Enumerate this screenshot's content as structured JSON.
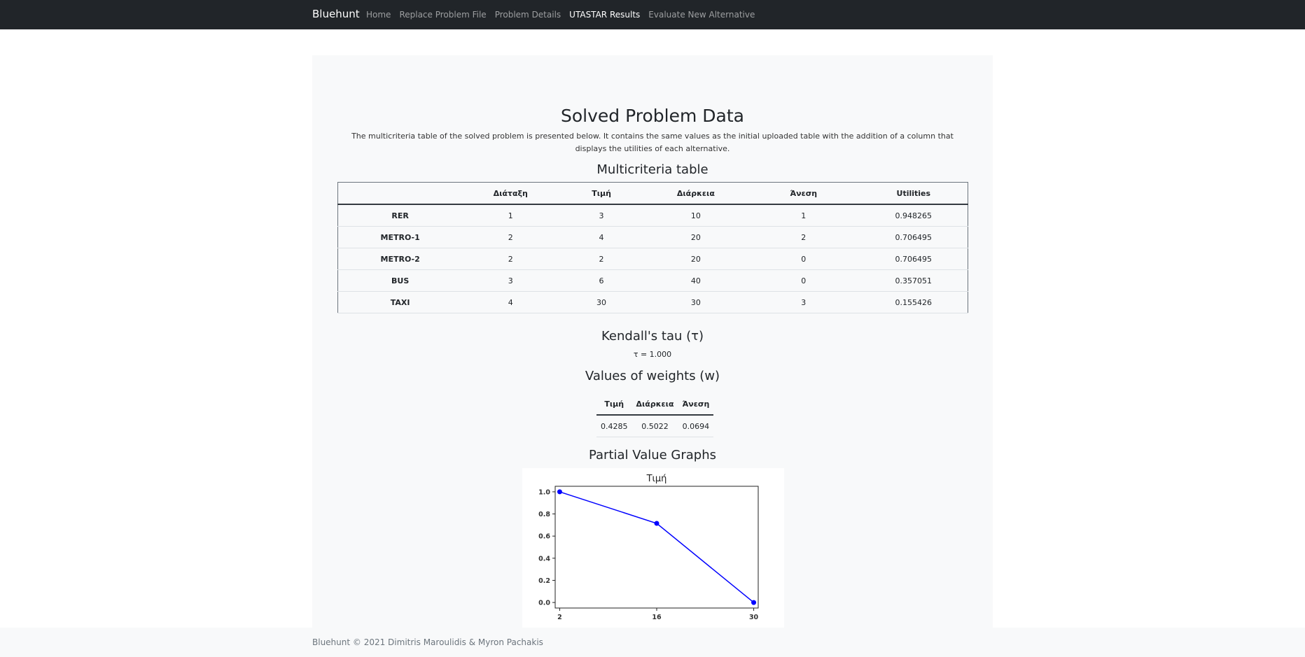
{
  "navbar": {
    "brand": "Bluehunt",
    "items": [
      {
        "label": "Home",
        "active": false
      },
      {
        "label": "Replace Problem File",
        "active": false
      },
      {
        "label": "Problem Details",
        "active": false
      },
      {
        "label": "UTASTAR Results",
        "active": true
      },
      {
        "label": "Evaluate New Alternative",
        "active": false
      }
    ]
  },
  "main": {
    "title": "Solved Problem Data",
    "intro": "The multicriteria table of the solved problem is presented below. It contains the same values as the initial uploaded table with the addition of a column that displays the utilities of each alternative.",
    "multicriteria": {
      "heading": "Multicriteria table",
      "columns": [
        "",
        "Διάταξη",
        "Τιμή",
        "Διάρκεια",
        "Άνεση",
        "Utilities"
      ],
      "rows": [
        {
          "name": "RER",
          "values": [
            "1",
            "3",
            "10",
            "1",
            "0.948265"
          ]
        },
        {
          "name": "METRO-1",
          "values": [
            "2",
            "4",
            "20",
            "2",
            "0.706495"
          ]
        },
        {
          "name": "METRO-2",
          "values": [
            "2",
            "2",
            "20",
            "0",
            "0.706495"
          ]
        },
        {
          "name": "BUS",
          "values": [
            "3",
            "6",
            "40",
            "0",
            "0.357051"
          ]
        },
        {
          "name": "TAXI",
          "values": [
            "4",
            "30",
            "30",
            "3",
            "0.155426"
          ]
        }
      ]
    },
    "kendall": {
      "heading": "Kendall's tau (τ)",
      "value": "τ = 1.000"
    },
    "weights": {
      "heading": "Values of weights (w)",
      "columns": [
        "Τιμή",
        "Διάρκεια",
        "Άνεση"
      ],
      "values": [
        "0.4285",
        "0.5022",
        "0.0694"
      ]
    },
    "graphs": {
      "heading": "Partial Value Graphs"
    }
  },
  "chart_data": {
    "type": "line",
    "title": "Τιμή",
    "xlabel": "",
    "ylabel": "",
    "x": [
      2,
      16,
      30
    ],
    "xticks": [
      "2",
      "16",
      "30"
    ],
    "yticks": [
      "0.0",
      "0.2",
      "0.4",
      "0.6",
      "0.8",
      "1.0"
    ],
    "series": [
      {
        "values": [
          1.0,
          0.715,
          0.0
        ]
      }
    ],
    "xlim": [
      1.35,
      30.65
    ],
    "ylim": [
      -0.05,
      1.05
    ],
    "grid": false,
    "colors": {
      "line": "#0000ff",
      "marker": "#0000ff"
    }
  },
  "footer": {
    "text": "Bluehunt © 2021 Dimitris Maroulidis & Myron Pachakis"
  }
}
